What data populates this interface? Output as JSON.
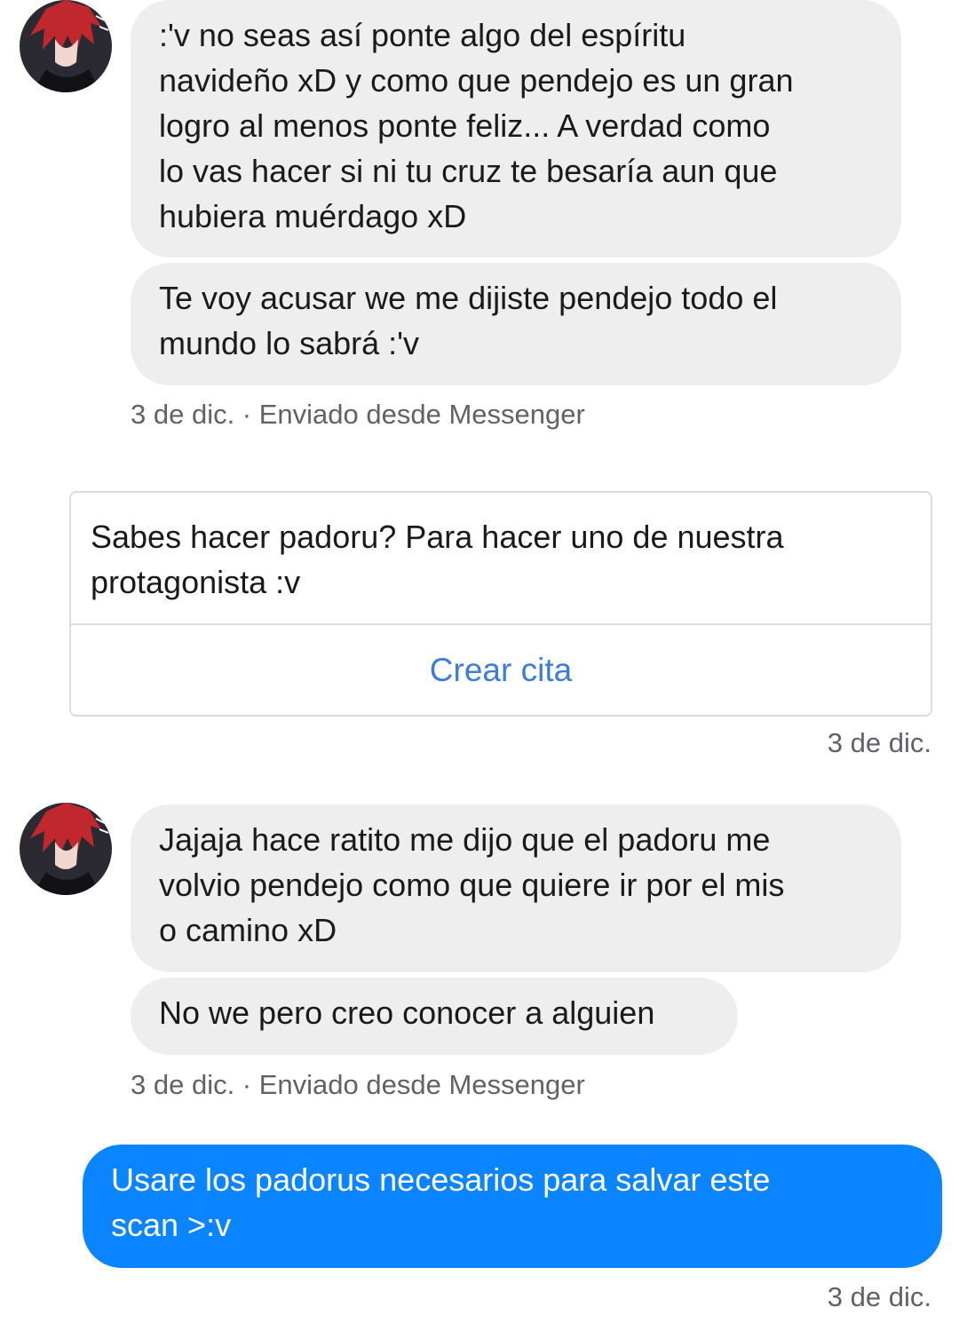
{
  "colors": {
    "incoming_bubble": "#eeeeee",
    "outgoing_bubble": "#0a84ff",
    "link": "#3b7dd8",
    "meta_text": "#5f6368"
  },
  "conversation": {
    "group1": {
      "avatar_icon": "user-avatar-anime-red-hair",
      "message1": ":'v no seas así ponte algo del espíritu\nnavideño xD y como que pendejo es un gran\nlogro al menos ponte feliz... A verdad como\nlo vas hacer si ni tu cruz te besaría aun que\nhubiera muérdago xD",
      "message2": "Te voy acusar we me dijiste pendejo todo el\nmundo lo sabrá :'v",
      "meta": "3 de dic. · Enviado desde Messenger"
    },
    "card": {
      "text": "Sabes hacer padoru? Para hacer uno de nuestra\nprotagonista :v",
      "action_label": "Crear cita",
      "meta": "3 de dic."
    },
    "group2": {
      "avatar_icon": "user-avatar-anime-red-hair",
      "message1": "Jajaja hace ratito me dijo que el padoru me\nvolvio pendejo como que quiere ir por el mis\no camino xD",
      "message2": "No we pero creo conocer a alguien",
      "meta": "3 de dic. · Enviado desde Messenger"
    },
    "outgoing": {
      "message": "Usare los padorus necesarios para salvar este\nscan >:v",
      "meta": "3 de dic."
    }
  }
}
